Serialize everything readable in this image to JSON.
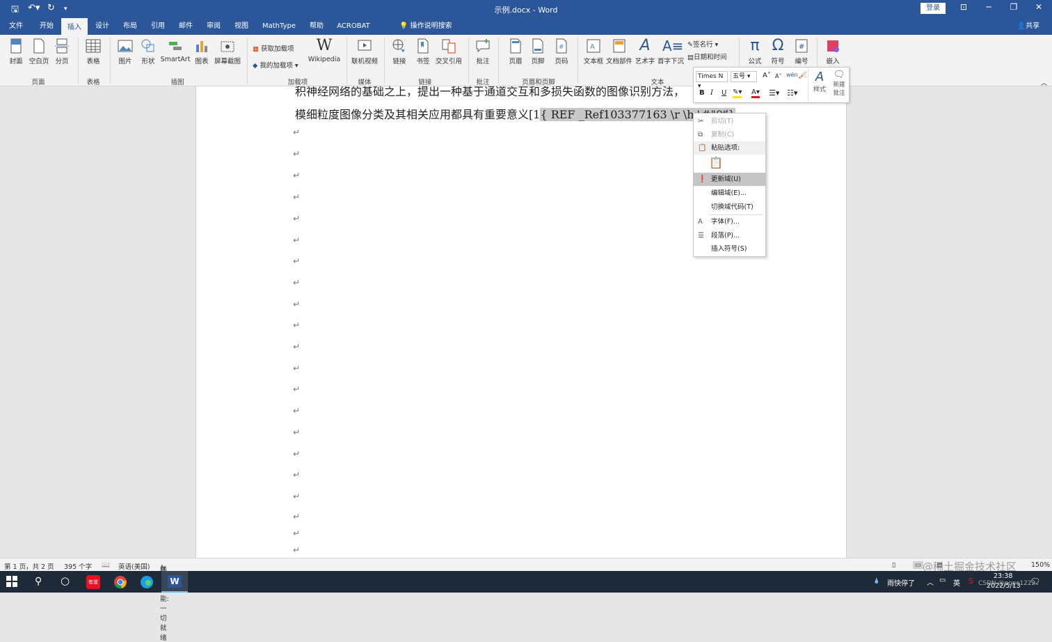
{
  "titlebar": {
    "title": "示例.docx  -  Word",
    "login": "登录",
    "minimize": "─",
    "restore": "❐",
    "close": "✕",
    "ribbon_display": "⊡"
  },
  "tabs": [
    "文件",
    "开始",
    "插入",
    "设计",
    "布局",
    "引用",
    "邮件",
    "审阅",
    "视图",
    "MathType",
    "帮助",
    "ACROBAT"
  ],
  "tell_me": "操作说明搜索",
  "share": "共享",
  "ribbon": {
    "pages": {
      "items": [
        "封面",
        "空白页",
        "分页"
      ],
      "group": "页面"
    },
    "tables": {
      "items": [
        "表格"
      ],
      "group": "表格"
    },
    "illustrations": {
      "items": [
        "图片",
        "形状",
        "SmartArt",
        "图表",
        "屏幕截图"
      ],
      "group": "插图"
    },
    "addins": {
      "get": "获取加载项",
      "mine": "我的加载项",
      "wiki": "Wikipedia",
      "group": "加载项"
    },
    "media": {
      "items": [
        "联机视频"
      ],
      "group": "媒体"
    },
    "links": {
      "items": [
        "链接",
        "书签",
        "交叉引用"
      ],
      "link_label": "链\n接",
      "group": "链接"
    },
    "comments": {
      "items": [
        "批注"
      ],
      "group": "批注"
    },
    "headerfooter": {
      "items": [
        "页眉",
        "页脚",
        "页码"
      ],
      "group": "页眉和页脚"
    },
    "text": {
      "items": [
        "文本框",
        "文档部件",
        "艺术字",
        "首字下沉"
      ],
      "signature": "签名行",
      "datetime": "日期和时间",
      "group": "文本"
    },
    "symbols": {
      "items": [
        "公式",
        "符号",
        "编号"
      ]
    },
    "embed": {
      "items": [
        "嵌入"
      ]
    }
  },
  "mini_toolbar": {
    "font": "Times N",
    "size": "五号",
    "styles": "样式",
    "new_comment": "新建\n批注",
    "bold": "B",
    "italic": "I",
    "underline": "U"
  },
  "document": {
    "line1": "积神经网络的基础之上，提出一种基于通道交互和多损失函数的图像识别方法，",
    "line2_text": "模细粒度图像分类及其相关应用都具有重要意义[1",
    "line2_field": "{ REF _Ref103377163 \\r \\h \\#\"0\"}",
    "para_mark": "↵"
  },
  "context_menu": {
    "cut": "剪切(T)",
    "copy": "复制(C)",
    "paste_options": "粘贴选项:",
    "update_field": "更新域(U)",
    "edit_field": "编辑域(E)...",
    "toggle_codes": "切换域代码(T)",
    "font": "字体(F)...",
    "paragraph": "段落(P)...",
    "insert_symbol": "插入符号(S)"
  },
  "status": {
    "page": "第 1 页，共 2 页",
    "words": "395 个字",
    "lang": "英语(美国)",
    "access": "辅助功能: 一切就绪",
    "zoom": "150%"
  },
  "watermark": "@稀土掘金技术社区",
  "watermark2": "CSDN @popc1222",
  "taskbar": {
    "weather": "雨快停了",
    "time": "23:38",
    "date": "2022/5/13",
    "ime": "英"
  },
  "colors": {
    "word_blue": "#2b579a",
    "ribbon": "#f3f3f3",
    "taskbar": "#1f2a38"
  }
}
